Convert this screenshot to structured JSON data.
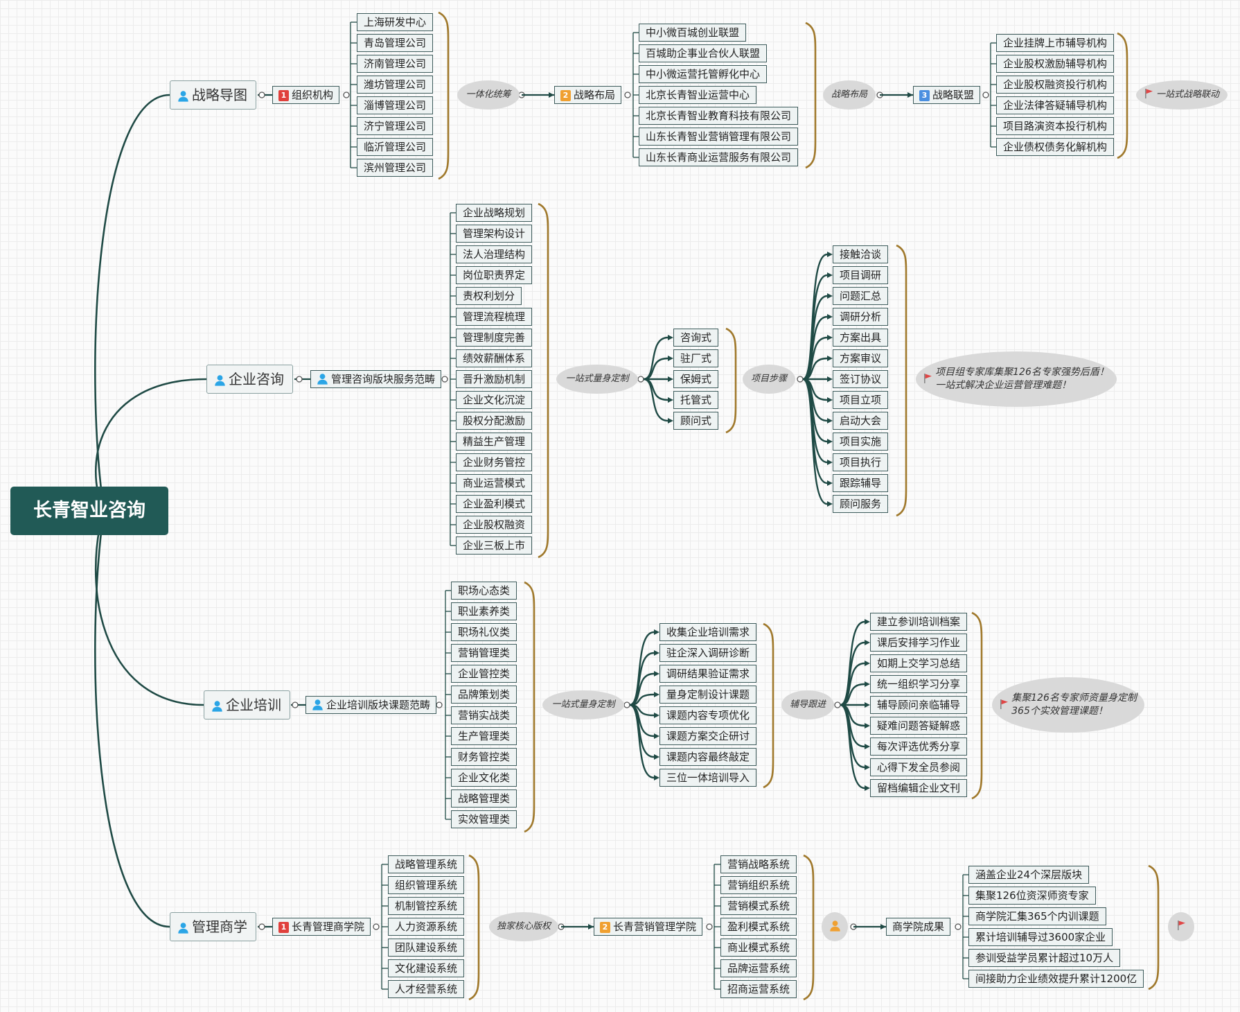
{
  "colors": {
    "edge": "#1f4a45",
    "brace": "#a0792c",
    "badge_red": "#e0403c",
    "badge_orange": "#f0a030",
    "badge_blue": "#4a8fe0",
    "person": "#2aa5e6",
    "person_orange": "#f0a030",
    "flag": "#e04545"
  },
  "root": {
    "label": "长青智业咨询"
  },
  "branch1": {
    "main": "战略导图",
    "n1": {
      "badge": "1",
      "label": "组织机构"
    },
    "l1": [
      "上海研发中心",
      "青岛管理公司",
      "济南管理公司",
      "潍坊管理公司",
      "淄博管理公司",
      "济宁管理公司",
      "临沂管理公司",
      "滨州管理公司"
    ],
    "o1": "一体化统筹",
    "n2": {
      "badge": "2",
      "label": "战略布局"
    },
    "l2": [
      "中小微百城创业联盟",
      "百城助企事业合伙人联盟",
      "中小微运营托管孵化中心",
      "北京长青智业运营中心",
      "北京长青智业教育科技有限公司",
      "山东长青智业营销管理有限公司",
      "山东长青商业运营服务有限公司"
    ],
    "o2": "战略布局",
    "n3": {
      "badge": "3",
      "label": "战略联盟"
    },
    "l3": [
      "企业挂牌上市辅导机构",
      "企业股权激励辅导机构",
      "企业股权融资投行机构",
      "企业法律答疑辅导机构",
      "项目路演资本投行机构",
      "企业债权债务化解机构"
    ],
    "o3": "一站式战略联动"
  },
  "branch2": {
    "main": "企业咨询",
    "n1": "管理咨询版块服务范畴",
    "l1": [
      "企业战略规划",
      "管理架构设计",
      "法人治理结构",
      "岗位职责界定",
      "责权利划分",
      "管理流程梳理",
      "管理制度完善",
      "绩效薪酬体系",
      "晋升激励机制",
      "企业文化沉淀",
      "股权分配激励",
      "精益生产管理",
      "企业财务管控",
      "商业运营模式",
      "企业盈利模式",
      "企业股权融资",
      "企业三板上市"
    ],
    "o1": "一站式量身定制",
    "l2": [
      "咨询式",
      "驻厂式",
      "保姆式",
      "托管式",
      "顾问式"
    ],
    "o2": "项目步骤",
    "l3": [
      "接触洽谈",
      "项目调研",
      "问题汇总",
      "调研分析",
      "方案出具",
      "方案审议",
      "签订协议",
      "项目立项",
      "启动大会",
      "项目实施",
      "项目执行",
      "跟踪辅导",
      "顾问服务"
    ],
    "o3": "项目组专家库集聚126名专家强势后盾！\n一站式解决企业运营管理难题！"
  },
  "branch3": {
    "main": "企业培训",
    "n1": "企业培训版块课题范畴",
    "l1": [
      "职场心态类",
      "职业素养类",
      "职场礼仪类",
      "营销管理类",
      "企业管控类",
      "品牌策划类",
      "营销实战类",
      "生产管理类",
      "财务管控类",
      "企业文化类",
      "战略管理类",
      "实效管理类"
    ],
    "o1": "一站式量身定制",
    "l2": [
      "收集企业培训需求",
      "驻企深入调研诊断",
      "调研结果验证需求",
      "量身定制设计课题",
      "课题内容专项优化",
      "课题方案交企研讨",
      "课题内容最终敲定",
      "三位一体培训导入"
    ],
    "o2": "辅导跟进",
    "l3": [
      "建立参训培训档案",
      "课后安排学习作业",
      "如期上交学习总结",
      "统一组织学习分享",
      "辅导顾问亲临辅导",
      "疑难问题答疑解惑",
      "每次评选优秀分享",
      "心得下发全员参阅",
      "留档编辑企业文刊"
    ],
    "o3": "集聚126名专家师资量身定制\n365个实效管理课题！"
  },
  "branch4": {
    "main": "管理商学",
    "n1": {
      "badge": "1",
      "label": "长青管理商学院"
    },
    "l1": [
      "战略管理系统",
      "组织管理系统",
      "机制管控系统",
      "人力资源系统",
      "团队建设系统",
      "文化建设系统",
      "人才经营系统"
    ],
    "o1": "独家核心版权",
    "n2": {
      "badge": "2",
      "label": "长青营销管理学院"
    },
    "l2": [
      "营销战略系统",
      "营销组织系统",
      "营销模式系统",
      "盈利模式系统",
      "商业模式系统",
      "品牌运营系统",
      "招商运营系统"
    ],
    "n3": "商学院成果",
    "l3": [
      "涵盖企业24个深层版块",
      "集聚126位资深师资专家",
      "商学院汇集365个内训课题",
      "累计培训辅导过3600家企业",
      "参训受益学员累计超过10万人",
      "间接助力企业绩效提升累计1200亿"
    ]
  }
}
